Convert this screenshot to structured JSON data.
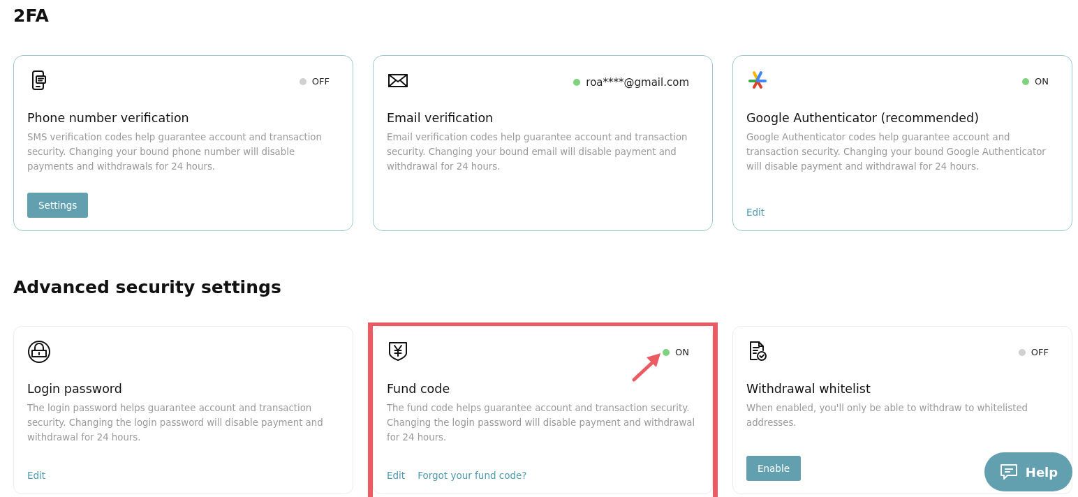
{
  "sections": [
    {
      "title": "2FA",
      "cards": [
        {
          "kind": "phone",
          "status": {
            "on": false,
            "label": "OFF"
          },
          "title": "Phone number verification",
          "description": "SMS verification codes help guarantee account and transaction security. Changing your bound phone number will disable payments and withdrawals for 24 hours.",
          "highlighted": false,
          "actions": [
            {
              "kind": "button",
              "label": "Settings"
            }
          ]
        },
        {
          "kind": "mail",
          "status": {
            "on": true,
            "label": "roa****@gmail.com"
          },
          "title": "Email verification",
          "description": "Email verification codes help guarantee account and transaction security. Changing your bound email will disable payment and withdrawal for 24 hours.",
          "highlighted": false
        },
        {
          "kind": "authenticator",
          "status": {
            "on": true,
            "label": "ON"
          },
          "title": "Google Authenticator (recommended)",
          "description": "Google Authenticator codes help guarantee account and transaction security. Changing your bound Google Authenticator will disable payment and withdrawal for 24 hours.",
          "highlighted": false,
          "actions": [
            {
              "kind": "link",
              "label": "Edit"
            }
          ]
        }
      ]
    },
    {
      "title": "Advanced security settings",
      "cards": [
        {
          "kind": "lock",
          "title": "Login password",
          "description": "The login password helps guarantee account and transaction security. Changing the login password will disable payment and withdrawal for 24 hours.",
          "highlighted": false,
          "actions": [
            {
              "kind": "link",
              "label": "Edit"
            }
          ]
        },
        {
          "kind": "fund",
          "status": {
            "on": true,
            "label": "ON"
          },
          "title": "Fund code",
          "description": "The fund code helps guarantee account and transaction security. Changing the login password will disable payment and withdrawal for 24 hours.",
          "highlighted": true,
          "actions": [
            {
              "kind": "link",
              "label": "Edit"
            },
            {
              "kind": "link",
              "label": "Forgot your fund code?"
            }
          ]
        },
        {
          "kind": "whitelist",
          "status": {
            "on": false,
            "label": "OFF"
          },
          "title": "Withdrawal whitelist",
          "description": "When enabled, you'll only be able to withdraw to whitelisted addresses.",
          "highlighted": false,
          "actions": [
            {
              "kind": "button",
              "label": "Enable"
            }
          ]
        }
      ]
    }
  ],
  "help_button": {
    "label": "Help"
  }
}
